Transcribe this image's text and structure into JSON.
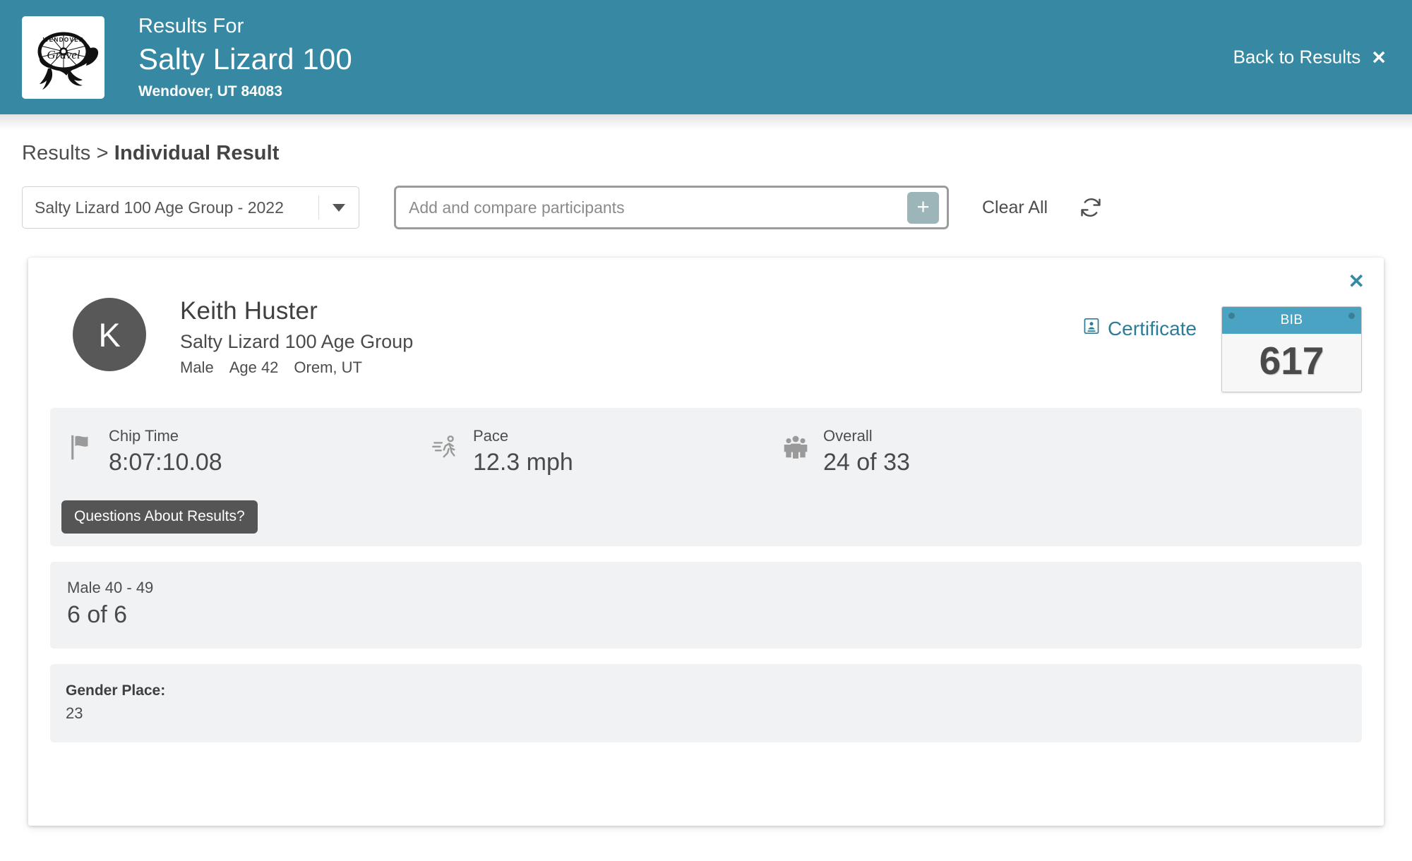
{
  "header": {
    "logo_alt": "wendover-gravel-lizard-logo",
    "pretitle": "Results For",
    "title": "Salty Lizard 100",
    "location": "Wendover, UT 84083",
    "back_label": "Back to Results",
    "back_close_glyph": "✕",
    "bg_color": "#3789a3"
  },
  "breadcrumb": {
    "root": "Results",
    "separator": ">",
    "current": "Individual Result"
  },
  "controls": {
    "race_select_value": "Salty Lizard 100 Age Group - 2022",
    "compare_placeholder": "Add and compare participants",
    "compare_value": "",
    "add_button_glyph": "+",
    "clear_all_label": "Clear All",
    "refresh_icon": "refresh-icon",
    "add_button_color": "#9cb5b8"
  },
  "result_card": {
    "close_glyph": "✕",
    "close_color": "#3789a3",
    "avatar_initial": "K",
    "name": "Keith Huster",
    "event": "Salty Lizard 100 Age Group",
    "meta": [
      "Male",
      "Age 42",
      "Orem, UT"
    ],
    "certificate_label": "Certificate",
    "certificate_color": "#2c7d97",
    "bib": {
      "label": "BIB",
      "number": "617",
      "header_color": "#4ba3c3"
    },
    "stats": [
      {
        "icon": "flag-icon",
        "label": "Chip Time",
        "value": "8:07:10.08"
      },
      {
        "icon": "runner-icon",
        "label": "Pace",
        "value": "12.3 mph"
      },
      {
        "icon": "people-icon",
        "label": "Overall",
        "value": "24 of 33"
      }
    ],
    "questions_button": "Questions About Results?",
    "division": {
      "label": "Male 40 - 49",
      "value": "6 of 6"
    },
    "gender_place": {
      "label": "Gender Place:",
      "value": "23"
    }
  }
}
